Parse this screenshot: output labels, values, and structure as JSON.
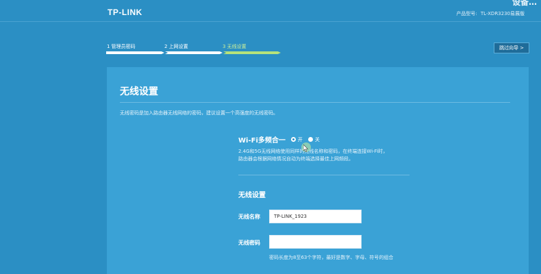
{
  "header": {
    "logo": "TP-LINK",
    "corner_text": "设备…",
    "model_label": "产品型号:",
    "model_value": "TL-XDR3230易展版"
  },
  "steps": [
    {
      "label": "1 管理员密码",
      "state": "done"
    },
    {
      "label": "2 上网设置",
      "state": "done"
    },
    {
      "label": "3 无线设置",
      "state": "active"
    }
  ],
  "skip_label": "跳过向导 >",
  "panel": {
    "title": "无线设置",
    "description": "无线密码是加入路由器无线网络的密码，建议设置一个高强度的无线密码。",
    "multiband": {
      "label": "Wi-Fi多频合一",
      "option_on": "开",
      "option_off": "关",
      "selected": "开",
      "desc_line1": "2.4G和5G无线网络使用同样的无线名称和密码，在终端连接Wi-Fi时，",
      "desc_line2": "路由器会根据网络情况自动为终端选择最佳上网频段。"
    },
    "wireless_section_title": "无线设置",
    "ssid_label": "无线名称",
    "ssid_value": "TP-LINK_1923",
    "password_label": "无线密码",
    "password_value": "",
    "password_hint": "密码长度为8至63个字符，最好是数字、字母、符号的组合"
  },
  "colors": {
    "background": "#2b8fc4",
    "panel": "#3aa2d6",
    "active_step": "#b6e27a"
  }
}
